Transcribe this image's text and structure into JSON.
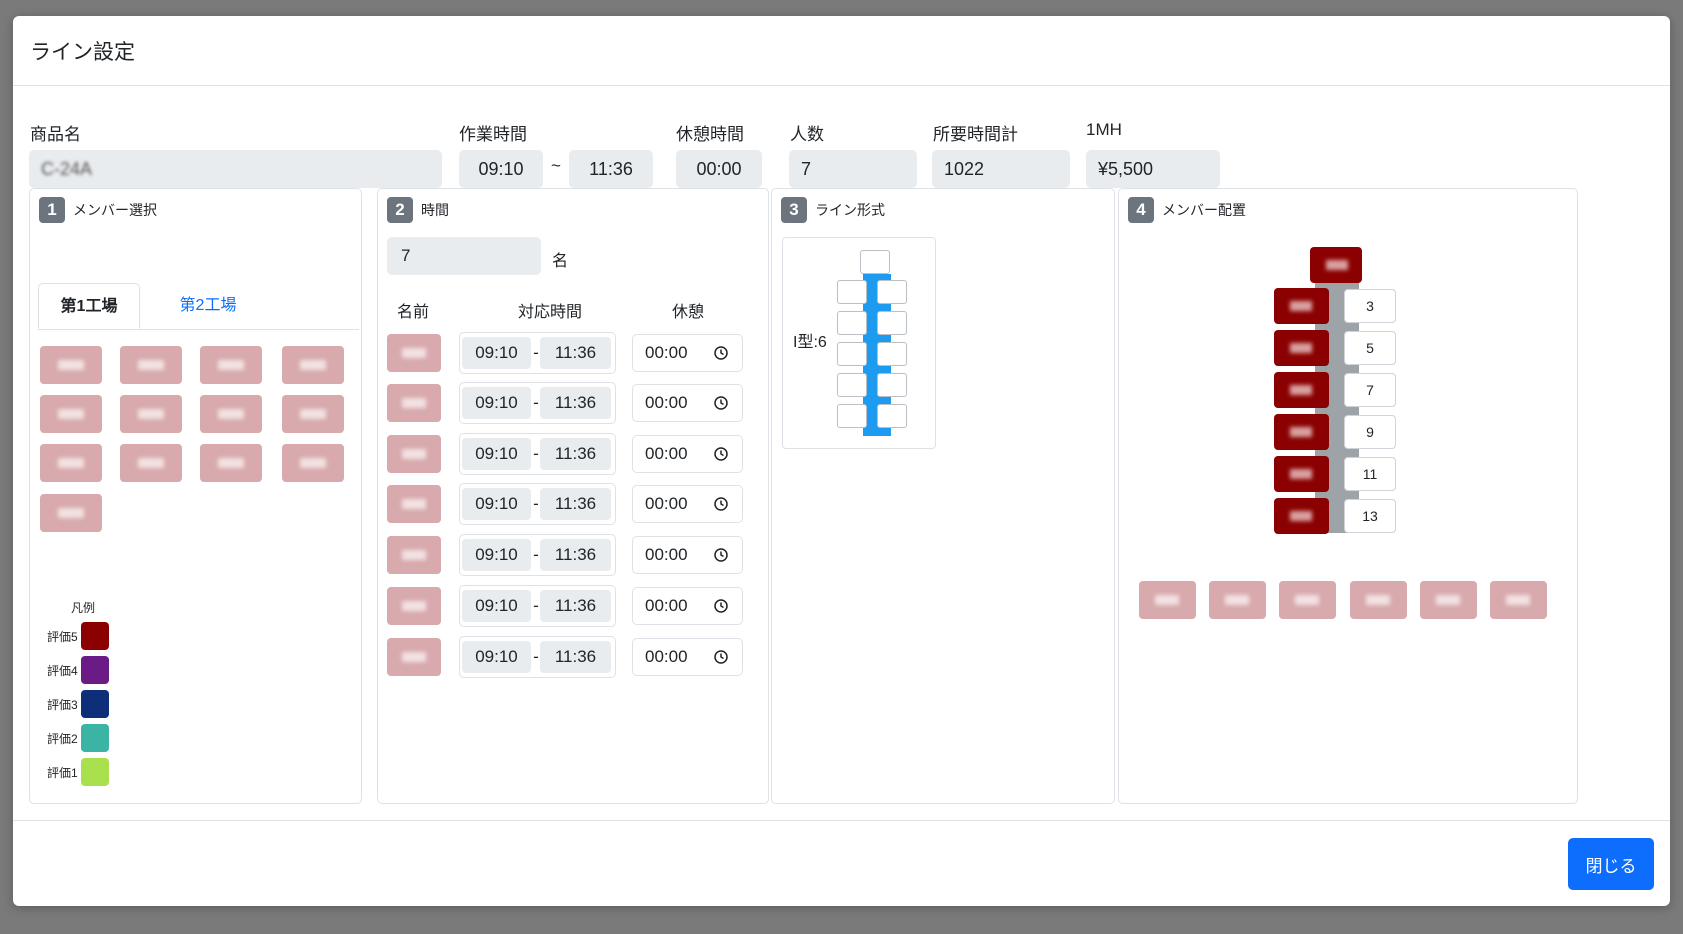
{
  "modal": {
    "title": "ライン設定"
  },
  "info": {
    "product_label": "商品名",
    "product_value": "C-24A",
    "work_time_label": "作業時間",
    "work_start": "09:10",
    "tilde": "~",
    "work_end": "11:36",
    "break_label": "休憩時間",
    "break_value": "00:00",
    "people_label": "人数",
    "people_value": "7",
    "total_time_label": "所要時間計",
    "total_time_value": "1022",
    "mh_label": "1MH",
    "mh_value": "¥5,500"
  },
  "panel1": {
    "num": "1",
    "title": "メンバー選択",
    "tabs": [
      "第1工場",
      "第2工場"
    ],
    "legend_title": "凡例",
    "legend": [
      {
        "label": "評価5",
        "color": "#8b0000"
      },
      {
        "label": "評価4",
        "color": "#6a1b86"
      },
      {
        "label": "評価3",
        "color": "#0d2f7a"
      },
      {
        "label": "評価2",
        "color": "#3bb3a5"
      },
      {
        "label": "評価1",
        "color": "#a9e04d"
      }
    ]
  },
  "panel2": {
    "num": "2",
    "title": "時間",
    "count": "7",
    "count_unit": "名",
    "headers": [
      "名前",
      "対応時間",
      "休憩"
    ],
    "rows": [
      {
        "start": "09:10",
        "dash": "-",
        "end": "11:36",
        "rest": "00:00"
      },
      {
        "start": "09:10",
        "dash": "-",
        "end": "11:36",
        "rest": "00:00"
      },
      {
        "start": "09:10",
        "dash": "-",
        "end": "11:36",
        "rest": "00:00"
      },
      {
        "start": "09:10",
        "dash": "-",
        "end": "11:36",
        "rest": "00:00"
      },
      {
        "start": "09:10",
        "dash": "-",
        "end": "11:36",
        "rest": "00:00"
      },
      {
        "start": "09:10",
        "dash": "-",
        "end": "11:36",
        "rest": "00:00"
      },
      {
        "start": "09:10",
        "dash": "-",
        "end": "11:36",
        "rest": "00:00"
      }
    ]
  },
  "panel3": {
    "num": "3",
    "title": "ライン形式",
    "line_type": "I型:6"
  },
  "panel4": {
    "num": "4",
    "title": "メンバー配置",
    "positions": [
      "3",
      "5",
      "7",
      "9",
      "11",
      "13"
    ]
  },
  "footer": {
    "close_label": "閉じる"
  },
  "colors": {
    "primary": "#0d6efd",
    "line_blue": "#1d9bf0",
    "eval5": "#8b0000",
    "unassigned": "#d8a9ad"
  }
}
